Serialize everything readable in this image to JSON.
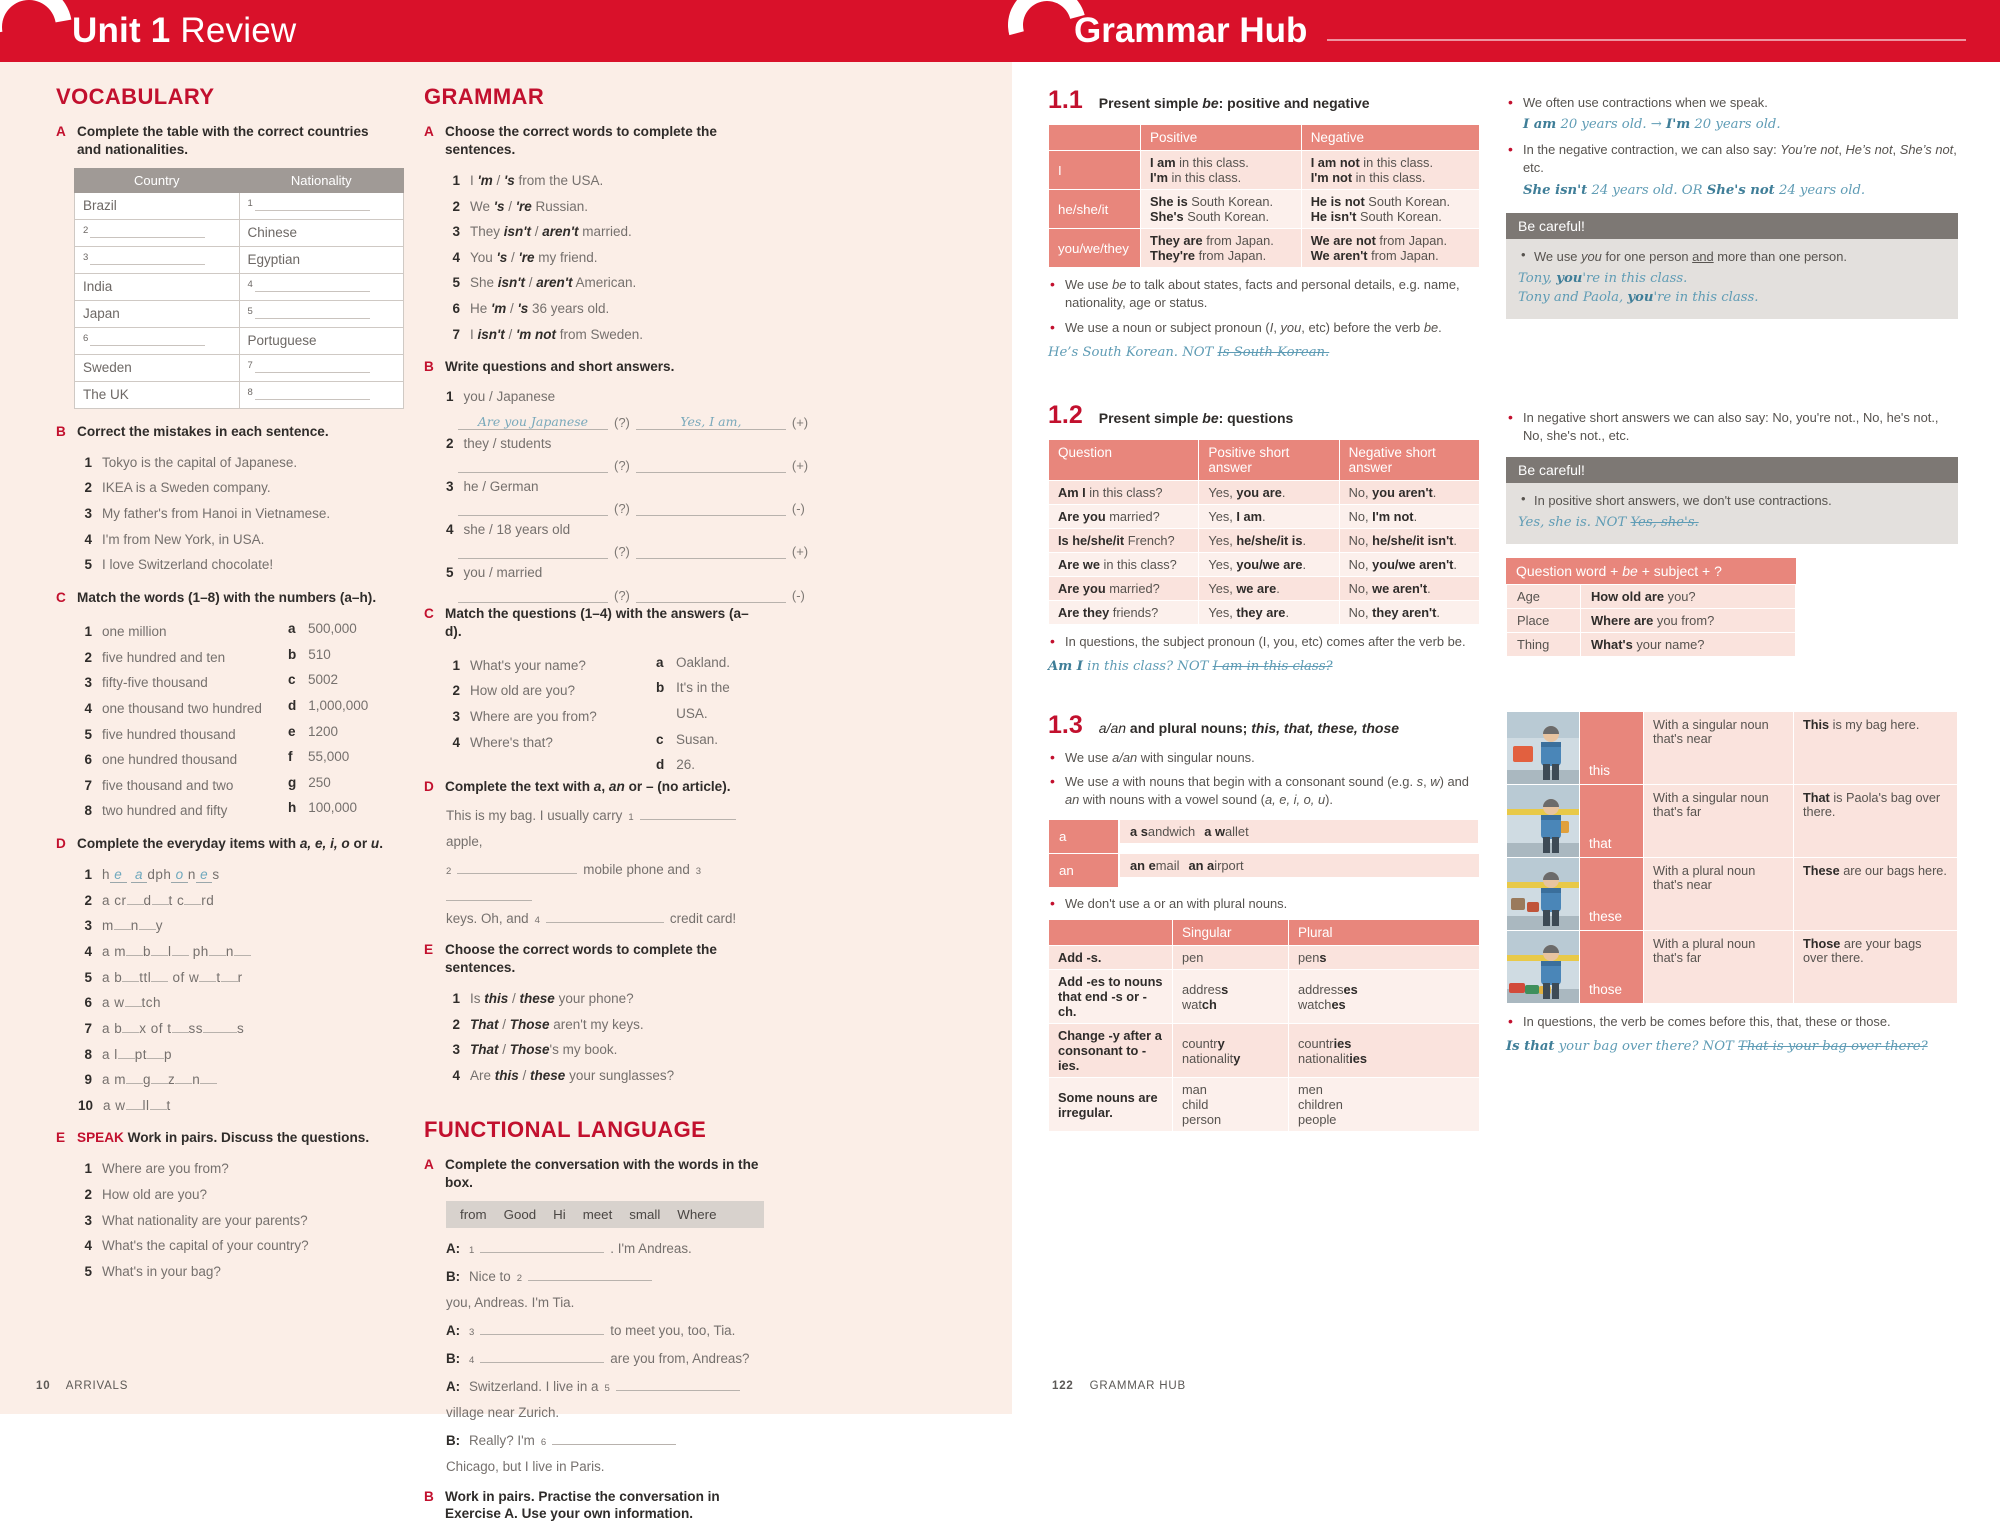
{
  "left_page": {
    "header": {
      "unit": "Unit 1",
      "sub": "Review"
    },
    "footer": {
      "page": "10",
      "label": "ARRIVALS"
    },
    "vocabulary": {
      "title": "VOCABULARY",
      "A": {
        "letter": "A",
        "instruction": "Complete the table with the correct countries and nationalities.",
        "headers": [
          "Country",
          "Nationality"
        ],
        "rows": [
          {
            "country": "Brazil",
            "country_blank": null,
            "nationality": null,
            "nationality_blank": "1"
          },
          {
            "country": null,
            "country_blank": "2",
            "nationality": "Chinese",
            "nationality_blank": null
          },
          {
            "country": null,
            "country_blank": "3",
            "nationality": "Egyptian",
            "nationality_blank": null
          },
          {
            "country": "India",
            "country_blank": null,
            "nationality": null,
            "nationality_blank": "4"
          },
          {
            "country": "Japan",
            "country_blank": null,
            "nationality": null,
            "nationality_blank": "5"
          },
          {
            "country": null,
            "country_blank": "6",
            "nationality": "Portuguese",
            "nationality_blank": null
          },
          {
            "country": "Sweden",
            "country_blank": null,
            "nationality": null,
            "nationality_blank": "7"
          },
          {
            "country": "The UK",
            "country_blank": null,
            "nationality": null,
            "nationality_blank": "8"
          }
        ]
      },
      "B": {
        "letter": "B",
        "instruction": "Correct the mistakes in each sentence.",
        "items": [
          "Tokyo is the capital of Japanese.",
          "IKEA is a Sweden company.",
          "My father's from Hanoi in Vietnamese.",
          "I'm from New York, in USA.",
          "I love Switzerland chocolate!"
        ]
      },
      "C": {
        "letter": "C",
        "instruction": "Match the words (1–8) with the numbers (a–h).",
        "words": [
          "one million",
          "five hundred and ten",
          "fifty-five thousand",
          "one thousand two hundred",
          "five hundred thousand",
          "one hundred thousand",
          "five thousand and two",
          "two hundred and fifty"
        ],
        "numbers": [
          {
            "letter": "a",
            "value": "500,000"
          },
          {
            "letter": "b",
            "value": "510"
          },
          {
            "letter": "c",
            "value": "5002"
          },
          {
            "letter": "d",
            "value": "1,000,000"
          },
          {
            "letter": "e",
            "value": "1200"
          },
          {
            "letter": "f",
            "value": "55,000"
          },
          {
            "letter": "g",
            "value": "250"
          },
          {
            "letter": "h",
            "value": "100,000"
          }
        ]
      },
      "D": {
        "letter": "D",
        "instruction_pre": "Complete the everyday items with ",
        "instruction_italic": "a, e, i, o",
        "instruction_mid": " or ",
        "instruction_italic2": "u",
        "instruction_post": ".",
        "items": [
          {
            "filled": true,
            "segments": [
              "h",
              "e",
              " ",
              "a",
              "dph",
              "o",
              "n",
              "e",
              "s"
            ]
          },
          {
            "raw": "a cr__d__t c__rd"
          },
          {
            "raw": "m__n__y"
          },
          {
            "raw": "a m__b__l__ ph__n__"
          },
          {
            "raw": "a b__ttl__ of w__t__r"
          },
          {
            "raw": "a w__tch"
          },
          {
            "raw": "a b__x of t__ss____s"
          },
          {
            "raw": "a l__pt__p"
          },
          {
            "raw": "a m__g__z__n__"
          },
          {
            "raw": "a w__ll__t"
          }
        ]
      },
      "E": {
        "letter": "E",
        "tag": "SPEAK",
        "instruction": "Work in pairs. Discuss the questions.",
        "items": [
          "Where are you from?",
          "How old are you?",
          "What nationality are your parents?",
          "What's the capital of your country?",
          "What's in your bag?"
        ]
      }
    },
    "grammar": {
      "title": "GRAMMAR",
      "A": {
        "letter": "A",
        "instruction": "Choose the correct words to complete the sentences.",
        "items": [
          {
            "pre": "I ",
            "opt1": "'m",
            "opt2": "'s",
            "post": " from the USA."
          },
          {
            "pre": "We ",
            "opt1": "'s",
            "opt2": "'re",
            "post": " Russian."
          },
          {
            "pre": "They ",
            "opt1": "isn't",
            "opt2": "aren't",
            "post": " married."
          },
          {
            "pre": "You ",
            "opt1": "'s",
            "opt2": "'re",
            "post": " my friend."
          },
          {
            "pre": "She ",
            "opt1": "isn't",
            "opt2": "aren't",
            "post": " American."
          },
          {
            "pre": "He ",
            "opt1": "'m",
            "opt2": "'s",
            "post": " 36 years old."
          },
          {
            "pre": "I ",
            "opt1": "isn't",
            "opt2": "'m not",
            "post": " from Sweden."
          }
        ]
      },
      "B": {
        "letter": "B",
        "instruction": "Write questions and short answers.",
        "items": [
          {
            "prompt": "you / Japanese",
            "answer_q": "Are you Japanese",
            "answer_a": "Yes, I am,",
            "sign": "(+)"
          },
          {
            "prompt": "they / students",
            "answer_q": "",
            "answer_a": "",
            "sign": "(+)"
          },
          {
            "prompt": "he / German",
            "answer_q": "",
            "answer_a": "",
            "sign": "(-)"
          },
          {
            "prompt": "she / 18 years old",
            "answer_q": "",
            "answer_a": "",
            "sign": "(+)"
          },
          {
            "prompt": "you / married",
            "answer_q": "",
            "answer_a": "",
            "sign": "(-)"
          }
        ]
      },
      "C": {
        "letter": "C",
        "instruction": "Match the questions (1–4) with the answers (a–d).",
        "questions": [
          "What's your name?",
          "How old are you?",
          "Where are you from?",
          "Where's that?"
        ],
        "answers": [
          {
            "letter": "a",
            "value": "Oakland."
          },
          {
            "letter": "b",
            "value": "It's in the USA."
          },
          {
            "letter": "c",
            "value": "Susan."
          },
          {
            "letter": "d",
            "value": "26."
          }
        ]
      },
      "D": {
        "letter": "D",
        "instruction": "Complete the text with a, an or – (no article).",
        "text_parts": [
          "This is my bag. I usually carry ",
          " apple,",
          " mobile phone and ",
          "keys. Oh, and ",
          " credit card!"
        ],
        "blank_nums": [
          "1",
          "2",
          "3",
          "4"
        ]
      },
      "E": {
        "letter": "E",
        "instruction": "Choose the correct words to complete the sentences.",
        "items": [
          {
            "pre": "Is ",
            "opt1": "this",
            "opt2": "these",
            "post": " your phone?"
          },
          {
            "pre": "",
            "opt1": "That",
            "opt2": "Those",
            "post": " aren't my keys."
          },
          {
            "pre": "",
            "opt1": "That",
            "opt2": "Those",
            "post": "'s my book."
          },
          {
            "pre": "Are ",
            "opt1": "this",
            "opt2": "these",
            "post": " your sunglasses?"
          }
        ]
      }
    },
    "functional": {
      "title": "FUNCTIONAL LANGUAGE",
      "A": {
        "letter": "A",
        "instruction": "Complete the conversation with the words in the box.",
        "words": [
          "from",
          "Good",
          "Hi",
          "meet",
          "small",
          "Where"
        ],
        "lines": [
          {
            "speaker": "A:",
            "num": "1",
            "pre": "",
            "post": ". I'm Andreas."
          },
          {
            "speaker": "B:",
            "num": "2",
            "pre": "Nice to ",
            "post": " you, Andreas. I'm Tia."
          },
          {
            "speaker": "A:",
            "num": "3",
            "pre": "",
            "post": " to meet you, too, Tia."
          },
          {
            "speaker": "B:",
            "num": "4",
            "pre": "",
            "post": " are you from, Andreas?"
          },
          {
            "speaker": "A:",
            "num": "5",
            "pre": "Switzerland. I live in a ",
            "post": " village near Zurich."
          },
          {
            "speaker": "B:",
            "num": "6",
            "pre": "Really? I'm ",
            "post": " Chicago, but I live in Paris."
          }
        ]
      },
      "B": {
        "letter": "B",
        "instruction": "Work in pairs. Practise the conversation in Exercise A. Use your own information."
      }
    }
  },
  "right_page": {
    "header": {
      "title": "Grammar Hub"
    },
    "footer": {
      "page": "122",
      "label": "GRAMMAR HUB"
    },
    "s11": {
      "num": "1.1",
      "title_pre": "Present simple ",
      "title_it": "be",
      "title_post": ": positive and negative",
      "headers": [
        "",
        "Positive",
        "Negative"
      ],
      "rows": [
        {
          "pronoun": "I",
          "pos": [
            [
              "I am",
              " in this class."
            ],
            [
              "I'm",
              " in this class."
            ]
          ],
          "neg": [
            [
              "I am not",
              " in this class."
            ],
            [
              "I'm not",
              " in this class."
            ]
          ]
        },
        {
          "pronoun": "he/she/it",
          "pos": [
            [
              "She is",
              " South Korean."
            ],
            [
              "She's",
              " South Korean."
            ]
          ],
          "neg": [
            [
              "He is not",
              " South Korean."
            ],
            [
              "He isn't",
              " South Korean."
            ]
          ]
        },
        {
          "pronoun": "you/we/they",
          "pos": [
            [
              "They are",
              " from Japan."
            ],
            [
              "They're",
              " from Japan."
            ]
          ],
          "neg": [
            [
              "We are not",
              " from Japan."
            ],
            [
              "We aren't",
              " from Japan."
            ]
          ]
        }
      ],
      "bullets": [
        "We use be to talk about states, facts and personal details, e.g. name, nationality, age or status.",
        "We use a noun or subject pronoun (I, you, etc) before the verb be."
      ],
      "hand_example": "He's South Korean. NOT Is South Korean.",
      "hand_strike": "Is South Korean.",
      "side_bullets": [
        "We often use contractions when we speak.",
        "In the negative contraction, we can also say: You're not, He's not, She's not, etc."
      ],
      "side_hand_1a": "I am",
      "side_hand_1b": " 20 years old. ",
      "side_hand_1c": "I'm",
      "side_hand_1d": " 20 years old.",
      "side_hand_2a": "She isn't",
      "side_hand_2b": " 24 years old. OR ",
      "side_hand_2c": "She's not",
      "side_hand_2d": " 24 years old.",
      "careful": {
        "title": "Be careful!",
        "bullet_pre": "We use ",
        "bullet_it": "you",
        "bullet_mid": " for one person ",
        "bullet_u": "and",
        "bullet_post": " more than one person.",
        "hand": [
          "Tony, ",
          "you",
          "'re in this class.",
          "Tony and Paola, ",
          "you",
          "'re in this class."
        ]
      }
    },
    "s12": {
      "num": "1.2",
      "title_pre": "Present simple ",
      "title_it": "be",
      "title_post": ": questions",
      "headers": [
        "Question",
        "Positive short answer",
        "Negative short answer"
      ],
      "rows": [
        {
          "q": [
            "Am I",
            " in this class?"
          ],
          "p": [
            "Yes, ",
            "you are",
            "."
          ],
          "n": [
            "No, ",
            "you aren't",
            "."
          ]
        },
        {
          "q": [
            "Are you",
            " married?"
          ],
          "p": [
            "Yes, ",
            "I am",
            "."
          ],
          "n": [
            "No, ",
            "I'm not",
            "."
          ]
        },
        {
          "q": [
            "Is he/she/it",
            " French?"
          ],
          "p": [
            "Yes, ",
            "he/she/it is",
            "."
          ],
          "n": [
            "No, ",
            "he/she/it isn't",
            "."
          ]
        },
        {
          "q": [
            "Are we",
            " in this class?"
          ],
          "p": [
            "Yes, ",
            "you/we are",
            "."
          ],
          "n": [
            "No, ",
            "you/we aren't",
            "."
          ]
        },
        {
          "q": [
            "Are you",
            " married?"
          ],
          "p": [
            "Yes, ",
            "we are",
            "."
          ],
          "n": [
            "No, ",
            "we aren't",
            "."
          ]
        },
        {
          "q": [
            "Are they",
            " friends?"
          ],
          "p": [
            "Yes, ",
            "they are",
            "."
          ],
          "n": [
            "No, ",
            "they aren't",
            "."
          ]
        }
      ],
      "bullet": "In questions, the subject pronoun (I, you, etc) comes after the verb be.",
      "hand_good": "Am I",
      "hand_good2": " in this class? NOT ",
      "hand_bad": "I am in this class?",
      "side_bullet": "In negative short answers we can also say: No, you're not., No, he's not., No, she's not., etc.",
      "careful": {
        "title": "Be careful!",
        "bullet": "In positive short answers, we don't use contractions.",
        "hand_good": "Yes, she is. NOT ",
        "hand_bad": "Yes, she's."
      },
      "qw_table": {
        "caption_pre": "Question word + ",
        "caption_it": "be",
        "caption_post": " + subject + ?",
        "rows": [
          {
            "k": "Age",
            "b": "How old are",
            "r": " you?"
          },
          {
            "k": "Place",
            "b": "Where are",
            "r": " you from?"
          },
          {
            "k": "Thing",
            "b": "What's",
            "r": " your name?"
          }
        ]
      }
    },
    "s13": {
      "num": "1.3",
      "title_it1": "a/an",
      "title_mid": " and plural nouns; ",
      "title_it2": "this, that, these, those",
      "bullets": [
        "We use a/an with singular nouns.",
        "We use a with nouns that begin with a consonant sound (e.g. s, w) and an with nouns with a vowel sound (a, e, i, o, u)."
      ],
      "aan_rows": [
        {
          "art": "a",
          "examples": [
            [
              "a s",
              "andwich"
            ],
            [
              "a w",
              "allet"
            ]
          ]
        },
        {
          "art": "an",
          "examples": [
            [
              "an e",
              "mail"
            ],
            [
              "an a",
              "irport"
            ]
          ]
        }
      ],
      "note": "We don't use a or an with plural nouns.",
      "plural_headers": [
        "",
        "Singular",
        "Plural"
      ],
      "plural_rows": [
        {
          "rule": "Add -s.",
          "rule_b": "-s.",
          "singular": [
            [
              "pen",
              ""
            ]
          ],
          "plural": [
            [
              "pen",
              "s"
            ]
          ]
        },
        {
          "rule": "Add -es to nouns that end -s or -ch.",
          "singular": [
            [
              "addres",
              "s"
            ],
            [
              "wat",
              "ch"
            ]
          ],
          "plural": [
            [
              "address",
              "es"
            ],
            [
              "watch",
              "es"
            ]
          ]
        },
        {
          "rule": "Change -y after a consonant to -ies.",
          "singular": [
            [
              "countr",
              "y"
            ],
            [
              "nationalit",
              "y"
            ]
          ],
          "plural": [
            [
              "countr",
              "ies"
            ],
            [
              "nationalit",
              "ies"
            ]
          ]
        },
        {
          "rule": "Some nouns are irregular.",
          "singular": [
            [
              "man",
              ""
            ],
            [
              "child",
              ""
            ],
            [
              "person",
              ""
            ]
          ],
          "plural": [
            [
              "men",
              ""
            ],
            [
              "children",
              ""
            ],
            [
              "people",
              ""
            ]
          ]
        }
      ],
      "dem_rows": [
        {
          "word": "this",
          "desc": "With a singular noun that's near",
          "ex_b": "This",
          "ex_r": " is my bag here."
        },
        {
          "word": "that",
          "desc": "With a singular noun that's far",
          "ex_b": "That",
          "ex_r": " is Paola's bag over there."
        },
        {
          "word": "these",
          "desc": "With a plural noun that's near",
          "ex_b": "These",
          "ex_r": " are our bags here."
        },
        {
          "word": "those",
          "desc": "With a plural noun that's far",
          "ex_b": "Those",
          "ex_r": " are your bags over there."
        }
      ],
      "dem_bullet": "In questions, the verb be comes before this, that, these or those.",
      "dem_hand_good": "Is that",
      "dem_hand_good2": " your bag over there? NOT ",
      "dem_hand_bad": "That is your bag over there?"
    }
  },
  "colors": {
    "brand_red": "#d9112a",
    "heading_red": "#c2102e",
    "table_salmon": "#e8867c",
    "table_pale": "#fae3dd",
    "grey_header": "#a09a96",
    "careful_grey": "#7d7874",
    "hand_blue": "#5f9cb5",
    "page_cream": "#fbeee7"
  }
}
